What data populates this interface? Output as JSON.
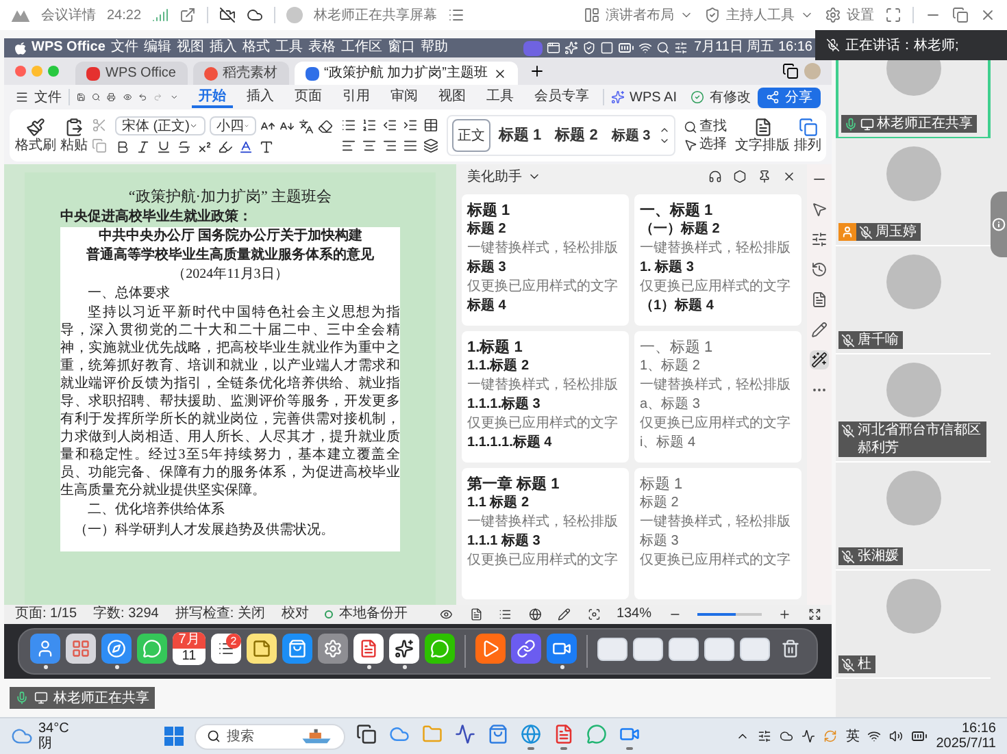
{
  "meeting_bar": {
    "title": "会议详情",
    "duration": "24:22",
    "share_status": "林老师正在共享屏幕",
    "layout_button": "演讲者布局",
    "host_tools_button": "主持人工具",
    "settings_button": "设置"
  },
  "speaking_banner": {
    "text": "正在讲话：林老师;"
  },
  "mac_menu_bar": {
    "app": "WPS Office",
    "items": [
      "文件",
      "编辑",
      "视图",
      "插入",
      "格式",
      "工具",
      "表格",
      "工作区",
      "窗口",
      "帮助"
    ],
    "clock": "7月11日 周五 16:16"
  },
  "wps": {
    "tabs": [
      {
        "label": "WPS Office",
        "kind": "home",
        "selected": false
      },
      {
        "label": "稻壳素材",
        "kind": "docer",
        "selected": false
      },
      {
        "label": "“政策护航 加力扩岗”主题班",
        "kind": "document",
        "selected": true
      }
    ],
    "file_menu": "文件",
    "ribbon_tabs": [
      {
        "label": "开始",
        "selected": true
      },
      {
        "label": "插入",
        "selected": false
      },
      {
        "label": "页面",
        "selected": false
      },
      {
        "label": "引用",
        "selected": false
      },
      {
        "label": "审阅",
        "selected": false
      },
      {
        "label": "视图",
        "selected": false
      },
      {
        "label": "工具",
        "selected": false
      },
      {
        "label": "会员专享",
        "selected": false
      }
    ],
    "ai_button": "WPS AI",
    "revision_button": "有修改",
    "share_button": "分享",
    "ribbon": {
      "format_painter": "格式刷",
      "paste": "粘贴",
      "font_name": "宋体 (正文)",
      "font_size": "小四",
      "styles": [
        {
          "label": "正文",
          "kind": "body",
          "selected": true
        },
        {
          "label": "标题 1",
          "kind": "h1",
          "selected": false
        },
        {
          "label": "标题 2",
          "kind": "h2",
          "selected": false
        },
        {
          "label": "标题 3",
          "kind": "h3",
          "selected": false
        }
      ],
      "find": "查找",
      "select": "选择",
      "text_layout": "文字排版",
      "arrange": "排列"
    },
    "document": {
      "title": "“政策护航·加力扩岗” 主题班会",
      "subtitle": "中央促进高校毕业生就业政策：",
      "box_heading": [
        "中共中央办公厅 国务院办公厅关于加快构建",
        "普通高等学校毕业生高质量就业服务体系的意见"
      ],
      "date": "（2024年11月3日）",
      "blocks": [
        {
          "kind": "heading",
          "text": "一、总体要求"
        },
        {
          "kind": "paragraph",
          "text": "坚持以习近平新时代中国特色社会主义思想为指导，深入贯彻党的二十大和二十届二中、三中全会精神，实施就业优先战略，把高校毕业生就业作为重中之重，统筹抓好教育、培训和就业，以产业端人才需求和就业端评价反馈为指引，全链条优化培养供给、就业指导、求职招聘、帮扶援助、监测评价等服务，开发更多有利于发挥所学所长的就业岗位，完善供需对接机制，力求做到人岗相适、用人所长、人尽其才，提升就业质量和稳定性。经过3至5年持续努力，基本建立覆盖全员、功能完备、保障有力的服务体系，为促进高校毕业生高质量充分就业提供坚实保障。"
        },
        {
          "kind": "heading",
          "text": "二、优化培养供给体系"
        },
        {
          "kind": "subheading",
          "text": "（一）科学研判人才发展趋势及供需状况。"
        }
      ]
    },
    "assistant_panel": {
      "title": "美化助手",
      "cards": [
        {
          "kind": "bold",
          "lines": [
            {
              "kind": "h1",
              "text": "标题 1"
            },
            {
              "kind": "h2",
              "text": "标题 2"
            },
            {
              "kind": "body",
              "text": "一键替换样式，轻松排版"
            },
            {
              "kind": "h3",
              "text": "标题 3"
            },
            {
              "kind": "body",
              "text": "仅更换已应用样式的文字"
            },
            {
              "kind": "h4",
              "text": "标题 4"
            }
          ]
        },
        {
          "kind": "bold",
          "lines": [
            {
              "kind": "h1",
              "text": "一、标题 1"
            },
            {
              "kind": "h2",
              "text": "（一）标题 2"
            },
            {
              "kind": "body",
              "text": "一键替换样式，轻松排版"
            },
            {
              "kind": "h3",
              "text": "1. 标题 3"
            },
            {
              "kind": "body",
              "text": "仅更换已应用样式的文字"
            },
            {
              "kind": "h4",
              "text": "（1）标题 4"
            }
          ]
        },
        {
          "kind": "bold",
          "lines": [
            {
              "kind": "h1",
              "text": "1.标题 1"
            },
            {
              "kind": "h2",
              "text": "1.1.标题 2"
            },
            {
              "kind": "body",
              "text": "一键替换样式，轻松排版"
            },
            {
              "kind": "h3",
              "text": "1.1.1.标题 3"
            },
            {
              "kind": "body",
              "text": "仅更换已应用样式的文字"
            },
            {
              "kind": "h4",
              "text": "1.1.1.1.标题 4"
            }
          ]
        },
        {
          "kind": "plain",
          "lines": [
            {
              "kind": "h1",
              "text": "一、标题 1"
            },
            {
              "kind": "h2",
              "text": "1、标题 2"
            },
            {
              "kind": "body",
              "text": "一键替换样式，轻松排版"
            },
            {
              "kind": "h3",
              "text": "a、标题 3"
            },
            {
              "kind": "body",
              "text": "仅更换已应用样式的文字"
            },
            {
              "kind": "h4",
              "text": "i、标题 4"
            }
          ]
        },
        {
          "kind": "bold",
          "lines": [
            {
              "kind": "h1",
              "text": "第一章 标题 1"
            },
            {
              "kind": "h2",
              "text": "1.1 标题 2"
            },
            {
              "kind": "body",
              "text": "一键替换样式，轻松排版"
            },
            {
              "kind": "h3",
              "text": "1.1.1 标题 3"
            },
            {
              "kind": "body",
              "text": "仅更换已应用样式的文字"
            }
          ]
        },
        {
          "kind": "plain",
          "lines": [
            {
              "kind": "h1",
              "text": "标题 1"
            },
            {
              "kind": "h2",
              "text": "标题 2"
            },
            {
              "kind": "body",
              "text": "一键替换样式，轻松排版"
            },
            {
              "kind": "h3",
              "text": "标题 3"
            },
            {
              "kind": "body",
              "text": "仅更换已应用样式的文字"
            }
          ]
        }
      ]
    },
    "side_tools": [
      {
        "kind": "collapse",
        "selected": false
      },
      {
        "kind": "select",
        "selected": false
      },
      {
        "kind": "adjust",
        "selected": false
      },
      {
        "kind": "history",
        "selected": false
      },
      {
        "kind": "review",
        "selected": false
      },
      {
        "kind": "pen",
        "selected": false
      },
      {
        "kind": "beautify",
        "selected": true
      },
      {
        "kind": "more",
        "selected": false
      }
    ],
    "status_bar": {
      "page": "页面: 1/15",
      "words": "字数: 3294",
      "spell_check": "拼写检查: 关闭",
      "proofread": "校对",
      "backup": "本地备份开",
      "zoom": "134%",
      "zoom_slider": {
        "level": 0.6
      }
    }
  },
  "dock": [
    {
      "kind": "finder",
      "running": true
    },
    {
      "kind": "launchpad",
      "running": false
    },
    {
      "kind": "safari",
      "running": true
    },
    {
      "kind": "messages",
      "running": false
    },
    {
      "kind": "calendar",
      "running": false,
      "month": "7月",
      "day": "11"
    },
    {
      "kind": "reminders",
      "running": false,
      "badge": "2"
    },
    {
      "kind": "notes",
      "running": false
    },
    {
      "kind": "appstore",
      "running": false
    },
    {
      "kind": "settings",
      "running": false
    },
    {
      "kind": "wps",
      "running": true
    },
    {
      "kind": "qq",
      "running": true
    },
    {
      "kind": "wechat",
      "running": false
    },
    {
      "kind": "separator"
    },
    {
      "kind": "video",
      "running": false
    },
    {
      "kind": "link",
      "running": false
    },
    {
      "kind": "meeting",
      "running": true
    },
    {
      "kind": "separator"
    },
    {
      "kind": "window",
      "running": false
    },
    {
      "kind": "window",
      "running": false
    },
    {
      "kind": "window",
      "running": false
    },
    {
      "kind": "window",
      "running": false
    },
    {
      "kind": "window",
      "running": false
    },
    {
      "kind": "trash",
      "running": false
    }
  ],
  "share_label": {
    "text": "林老师正在共享",
    "muted": false
  },
  "participants": [
    {
      "name": "林老师正在共享",
      "selected": true,
      "muted": false,
      "sharing": true,
      "host": false
    },
    {
      "name": "周玉婷",
      "selected": false,
      "muted": true,
      "sharing": false,
      "host": true
    },
    {
      "name": "唐千喻",
      "selected": false,
      "muted": true,
      "sharing": false,
      "host": false
    },
    {
      "name": "河北省邢台市信都区郝利芳",
      "selected": false,
      "muted": true,
      "sharing": false,
      "host": false
    },
    {
      "name": "张湘媛",
      "selected": false,
      "muted": true,
      "sharing": false,
      "host": false
    },
    {
      "name": "杜",
      "selected": false,
      "muted": true,
      "sharing": false,
      "host": false
    }
  ],
  "taskbar": {
    "temperature": "34°C",
    "weather": "阴",
    "search_placeholder": "搜索",
    "apps": [
      {
        "kind": "task-view",
        "running": false
      },
      {
        "kind": "cloud",
        "running": false
      },
      {
        "kind": "folder",
        "running": false
      },
      {
        "kind": "chart",
        "running": false
      },
      {
        "kind": "store",
        "running": false
      },
      {
        "kind": "browser",
        "running": true
      },
      {
        "kind": "wps",
        "running": true
      },
      {
        "kind": "green",
        "running": false
      },
      {
        "kind": "meeting",
        "running": true
      }
    ],
    "input_method": "英",
    "time": "16:16",
    "date": "2025/7/11"
  }
}
